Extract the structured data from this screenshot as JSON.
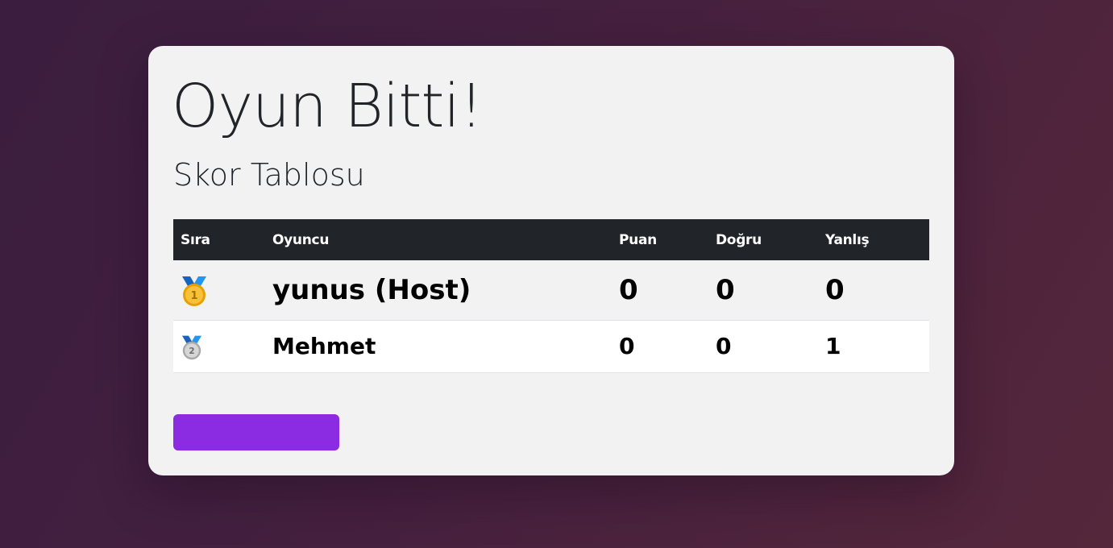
{
  "page": {
    "title": "Oyun Bitti!",
    "subtitle": "Skor Tablosu"
  },
  "table": {
    "headers": {
      "rank": "Sıra",
      "player": "Oyuncu",
      "score": "Puan",
      "correct": "Doğru",
      "wrong": "Yanlış"
    },
    "rows": [
      {
        "rank_icon": "gold-medal-icon",
        "rank_number": "1",
        "player": "yunus (Host)",
        "score": "0",
        "correct": "0",
        "wrong": "0"
      },
      {
        "rank_icon": "silver-medal-icon",
        "rank_number": "2",
        "player": "Mehmet",
        "score": "0",
        "correct": "0",
        "wrong": "1"
      }
    ]
  },
  "action_button": {
    "label": ""
  },
  "colors": {
    "accent": "#8b2be2",
    "table_header": "#212529",
    "card": "#f2f2f2",
    "gold": "#f5b31d",
    "silver": "#c9c9c9",
    "ribbon": "#1e88e5"
  }
}
